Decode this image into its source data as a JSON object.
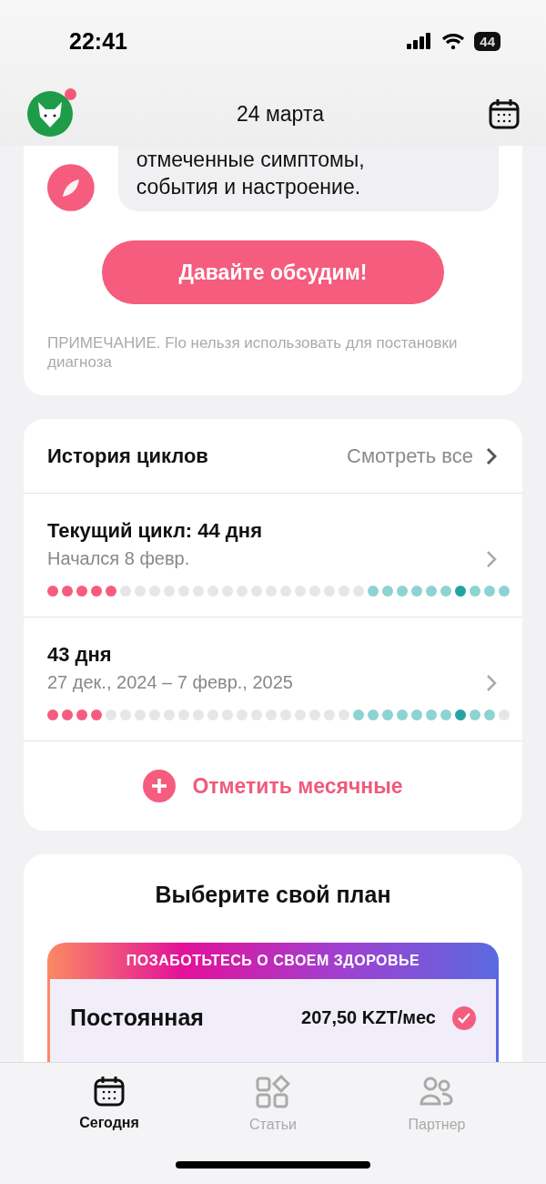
{
  "status_bar": {
    "time": "22:41",
    "battery": "44"
  },
  "header": {
    "date": "24 марта",
    "notification": true
  },
  "insight": {
    "message": "отмеченные симптомы, события и настроение.",
    "button": "Давайте обсудим!",
    "note": "ПРИМЕЧАНИЕ. Flo нельзя использовать для постановки диагноза"
  },
  "cycle_history": {
    "title": "История циклов",
    "see_all": "Смотреть все",
    "cycles": [
      {
        "title": "Текущий цикл: 44 дня",
        "dates": "Начался 8 февр.",
        "dots": [
          {
            "kind": "period"
          },
          {
            "kind": "period"
          },
          {
            "kind": "period"
          },
          {
            "kind": "period"
          },
          {
            "kind": "period"
          },
          {
            "kind": "none"
          },
          {
            "kind": "none"
          },
          {
            "kind": "none"
          },
          {
            "kind": "none"
          },
          {
            "kind": "none"
          },
          {
            "kind": "none"
          },
          {
            "kind": "none"
          },
          {
            "kind": "none"
          },
          {
            "kind": "none"
          },
          {
            "kind": "none"
          },
          {
            "kind": "none"
          },
          {
            "kind": "none"
          },
          {
            "kind": "none"
          },
          {
            "kind": "none"
          },
          {
            "kind": "none"
          },
          {
            "kind": "none"
          },
          {
            "kind": "none"
          },
          {
            "kind": "fertile"
          },
          {
            "kind": "fertile"
          },
          {
            "kind": "fertile"
          },
          {
            "kind": "fertile"
          },
          {
            "kind": "fertile"
          },
          {
            "kind": "fertile"
          },
          {
            "kind": "ovulation"
          },
          {
            "kind": "fertile"
          },
          {
            "kind": "fertile"
          },
          {
            "kind": "fertile"
          }
        ]
      },
      {
        "title": "43 дня",
        "dates": "27 дек., 2024 – 7 февр., 2025",
        "dots": [
          {
            "kind": "period"
          },
          {
            "kind": "period"
          },
          {
            "kind": "period"
          },
          {
            "kind": "period"
          },
          {
            "kind": "none"
          },
          {
            "kind": "none"
          },
          {
            "kind": "none"
          },
          {
            "kind": "none"
          },
          {
            "kind": "none"
          },
          {
            "kind": "none"
          },
          {
            "kind": "none"
          },
          {
            "kind": "none"
          },
          {
            "kind": "none"
          },
          {
            "kind": "none"
          },
          {
            "kind": "none"
          },
          {
            "kind": "none"
          },
          {
            "kind": "none"
          },
          {
            "kind": "none"
          },
          {
            "kind": "none"
          },
          {
            "kind": "none"
          },
          {
            "kind": "none"
          },
          {
            "kind": "fertile"
          },
          {
            "kind": "fertile"
          },
          {
            "kind": "fertile"
          },
          {
            "kind": "fertile"
          },
          {
            "kind": "fertile"
          },
          {
            "kind": "fertile"
          },
          {
            "kind": "fertile"
          },
          {
            "kind": "ovulation"
          },
          {
            "kind": "fertile"
          },
          {
            "kind": "fertile"
          },
          {
            "kind": "none"
          }
        ]
      }
    ],
    "log_button": "Отметить месячные"
  },
  "plans": {
    "title": "Выберите свой план",
    "banner": "ПОЗАБОТЬТЕСЬ О СВОЕМ ЗДОРОВЬЕ",
    "plan": {
      "name": "Постоянная",
      "price": "207,50 KZT/мес",
      "selected": true
    }
  },
  "tabs": [
    {
      "label": "Сегодня",
      "kind": "calendar",
      "selected": true
    },
    {
      "label": "Статьи",
      "kind": "grid",
      "selected": false
    },
    {
      "label": "Партнер",
      "kind": "people",
      "selected": false
    }
  ]
}
